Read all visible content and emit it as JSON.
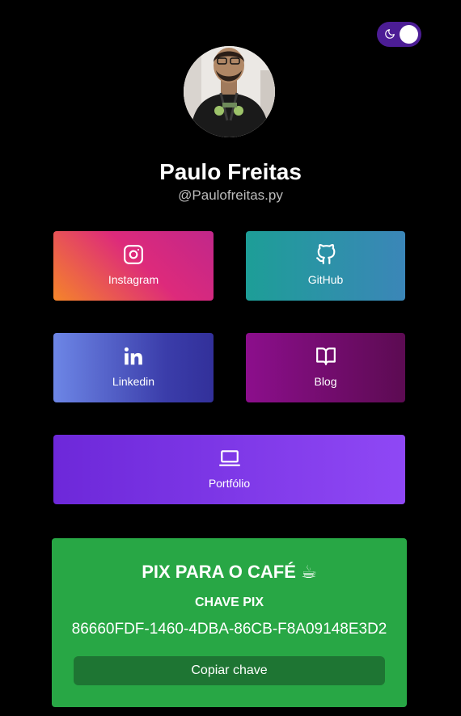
{
  "profile": {
    "name": "Paulo Freitas",
    "handle": "@Paulofreitas.py"
  },
  "links": {
    "instagram": {
      "label": "Instagram",
      "icon": "instagram-icon"
    },
    "github": {
      "label": "GitHub",
      "icon": "github-icon"
    },
    "linkedin": {
      "label": "Linkedin",
      "icon": "linkedin-icon"
    },
    "blog": {
      "label": "Blog",
      "icon": "book-icon"
    },
    "portfolio": {
      "label": "Portfólio",
      "icon": "laptop-icon"
    }
  },
  "pix": {
    "title": "PIX PARA O CAFÉ ☕",
    "subtitle": "CHAVE PIX",
    "key": "86660FDF-1460-4DBA-86CB-F8A09148E3D2",
    "copy_label": "Copiar chave"
  },
  "theme": {
    "mode": "dark",
    "toggle_icon": "moon-icon"
  },
  "colors": {
    "background": "#000000",
    "pix_green": "#28a745",
    "pix_button": "#1e7533",
    "toggle": "#4c1d95"
  }
}
